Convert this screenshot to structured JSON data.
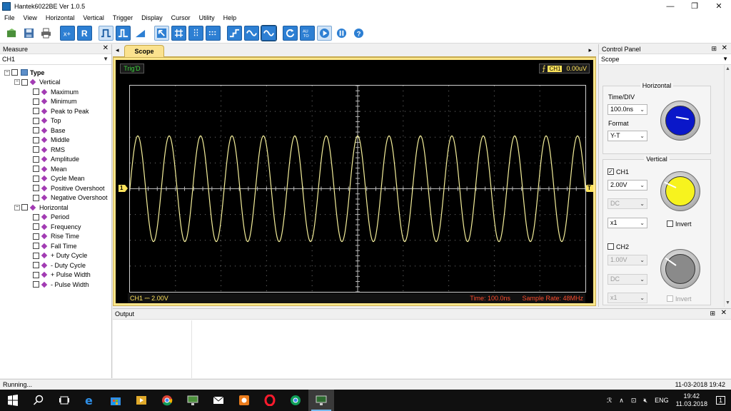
{
  "window": {
    "title": "Hantek6022BE Ver 1.0.5",
    "min": "—",
    "max": "❐",
    "close": "✕"
  },
  "menu": [
    "File",
    "View",
    "Horizontal",
    "Vertical",
    "Trigger",
    "Display",
    "Cursor",
    "Utility",
    "Help"
  ],
  "toolbar_icons": [
    "open-icon",
    "save-icon",
    "print-icon",
    "measure-icon",
    "reset-icon",
    "square-wave-icon",
    "pulse-icon",
    "ramp-icon",
    "cursor-icon",
    "grid-icon",
    "dots-icon",
    "dashes-icon",
    "step-icon",
    "sine-icon",
    "sine-active-icon",
    "refresh-icon",
    "auto-icon",
    "run-icon",
    "pause-icon",
    "help-icon"
  ],
  "toolbar_auto_label": "AU TO",
  "measure_panel": {
    "title": "Measure",
    "close": "✕",
    "channel": "CH1",
    "root": "Type",
    "vertical_group": "Vertical",
    "vertical_items": [
      "Maximum",
      "Minimum",
      "Peak to Peak",
      "Top",
      "Base",
      "Middle",
      "RMS",
      "Amplitude",
      "Mean",
      "Cycle Mean",
      "Positive Overshoot",
      "Negative Overshoot"
    ],
    "horizontal_group": "Horizontal",
    "horizontal_items": [
      "Period",
      "Frequency",
      "Rise Time",
      "Fall Time",
      "+ Duty Cycle",
      "- Duty Cycle",
      "+ Pulse Width",
      "- Pulse Width"
    ]
  },
  "scope": {
    "tab": "Scope",
    "nav_left": "◂",
    "nav_right": "▸",
    "trig_status": "Trig'D",
    "trig_edge": "⨍",
    "trig_channel": "CH1",
    "trig_level": "0.00uV",
    "ch_marker": "1",
    "trig_marker": "T",
    "channel_info": "CH1 ⎓  2.00V",
    "time": "Time: 100.0ns",
    "sample_rate": "Sample Rate: 48MHz",
    "trace_color": "#f5ef9a",
    "waveform": {
      "cycles": 14.5,
      "amplitude_divisions": 2.05,
      "phase_cycles": 0.25
    }
  },
  "output_panel": {
    "title": "Output",
    "pin": "⊞",
    "close": "✕"
  },
  "control_panel": {
    "title": "Control Panel",
    "pin": "⊞",
    "close": "✕",
    "mode": "Scope",
    "horizontal_title": "Horizontal",
    "time_div_label": "Time/DIV",
    "time_div_value": "100.0ns",
    "format_label": "Format",
    "format_value": "Y-T",
    "vertical_title": "Vertical",
    "ch1_label": "CH1",
    "ch1_checked": "✓",
    "ch1_volts": "2.00V",
    "ch1_coupling": "DC",
    "ch1_probe": "x1",
    "ch1_invert": "Invert",
    "ch2_label": "CH2",
    "ch2_volts": "1.00V",
    "ch2_coupling": "DC",
    "ch2_probe": "x1",
    "ch2_invert": "Invert",
    "knob_colors": {
      "time": "#0a17c9",
      "ch1": "#f7f31e",
      "ch2": "#8a8a8a"
    }
  },
  "statusbar": {
    "status": "Running...",
    "datetime": "11-03-2018 19:42"
  },
  "taskbar": {
    "apps": [
      "start-icon",
      "search-icon",
      "task-view-icon",
      "edge-icon",
      "store-icon",
      "media-icon",
      "chrome-icon",
      "monitor-icon",
      "mail-icon",
      "office-icon",
      "opera-icon",
      "chrome-alt-icon",
      "hantek-icon"
    ],
    "tray_lang": "ENG",
    "time": "19:42",
    "date": "11.03.2018",
    "notif": "1",
    "tray_person": "ℛ",
    "tray_caret": "∧",
    "tray_net": "⊡",
    "tray_vol": "🔇︎"
  }
}
